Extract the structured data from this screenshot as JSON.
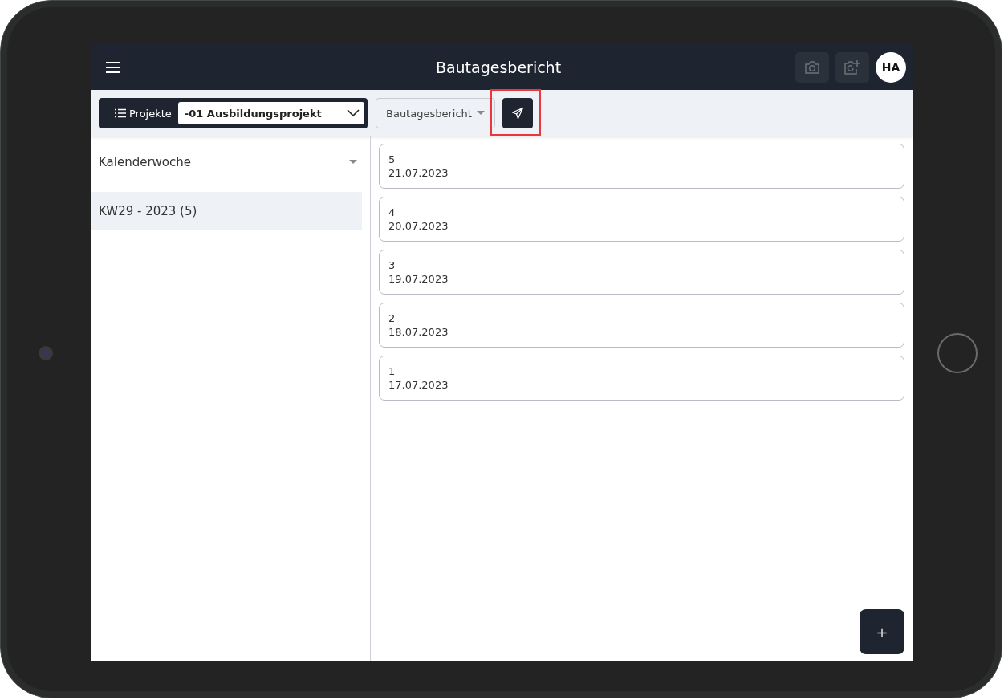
{
  "header": {
    "title": "Bautagesbericht",
    "avatar": "HA"
  },
  "toolbar": {
    "projects_label": "Projekte",
    "project": "-01 Ausbildungsprojekt",
    "report_type": "Bautagesbericht",
    "send_highlighted": true
  },
  "sidebar": {
    "filter": "Kalenderwoche",
    "weeks": [
      {
        "label": "KW29 - 2023 (5)",
        "selected": true
      }
    ]
  },
  "reports": [
    {
      "number": "5",
      "date": "21.07.2023"
    },
    {
      "number": "4",
      "date": "20.07.2023"
    },
    {
      "number": "3",
      "date": "19.07.2023"
    },
    {
      "number": "2",
      "date": "18.07.2023"
    },
    {
      "number": "1",
      "date": "17.07.2023"
    }
  ],
  "add_button": "+"
}
